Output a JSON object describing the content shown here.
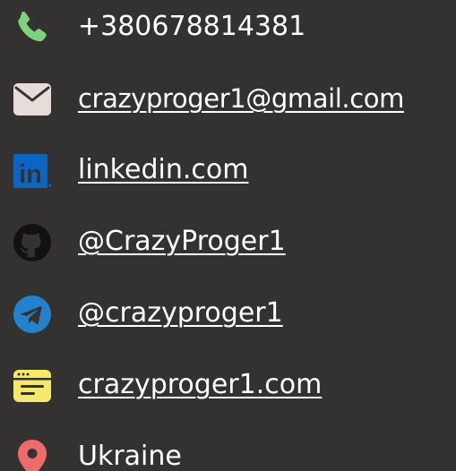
{
  "contacts": {
    "phone": {
      "text": "+380678814381",
      "icon": "phone-icon",
      "color": "#7ed37e"
    },
    "email": {
      "text": "crazyproger1@gmail.com",
      "icon": "envelope-icon",
      "color": "#e8dcd8"
    },
    "linkedin": {
      "text": "linkedin.com",
      "icon": "linkedin-icon",
      "color": "#0a66c2",
      "logo_text": "in"
    },
    "github": {
      "text": "@CrazyProger1",
      "icon": "github-icon",
      "color": "#111111"
    },
    "telegram": {
      "text": "@crazyproger1",
      "icon": "telegram-icon",
      "color": "#2481cc"
    },
    "website": {
      "text": "crazyproger1.com",
      "icon": "browser-window-icon",
      "color": "#f4e96b"
    },
    "location": {
      "text": "Ukraine",
      "icon": "map-pin-icon",
      "color": "#ef6b6b"
    }
  },
  "colors": {
    "background": "#343231",
    "text": "#ffffff"
  }
}
